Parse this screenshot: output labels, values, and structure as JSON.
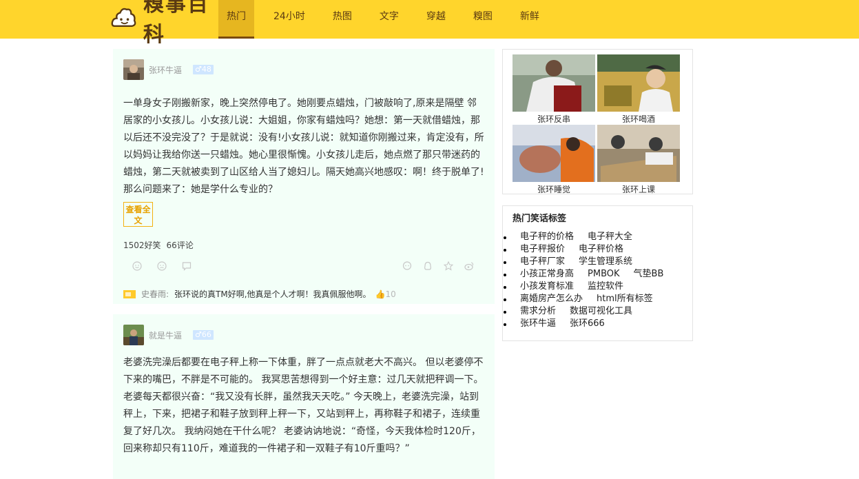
{
  "header": {
    "logo_text": "糗事百科",
    "nav": [
      "热门",
      "24小时",
      "热图",
      "文字",
      "穿越",
      "糗图",
      "新鲜"
    ],
    "active_nav": "热门"
  },
  "articles": [
    {
      "author": "张环牛逼",
      "level": "48",
      "content": "一单身女子刚搬新家，晚上突然停电了。她刚要点蜡烛，门被敲响了,原来是隔壁 邻居家的小女孩儿。小女孩儿说：大姐姐，你家有蜡烛吗？她想：第一天就借蜡烛，那以后还不没完没了？于是就说：没有!小女孩儿说：就知道你刚搬过来，肯定没有，所以妈妈让我给你送一只蜡烛。她心里很惭愧。小女孩儿走后，她点燃了那只带迷药的蜡烛，第二天就被卖到了山区给人当了媳妇儿。隔天她高兴地感叹：啊！终于脱单了!那么问题来了：她是学什么专业的？",
      "more_label": "查看全文",
      "funny": "1502好笑",
      "comments": "66评论",
      "hot_comment": {
        "user": "史春雨:",
        "text": "张环说的真TM好啊,他真是个人才啊！我真佩服他啊。",
        "likes": "10"
      }
    },
    {
      "author": "就是牛逼",
      "level": "66",
      "content": "老婆洗完澡后都要在电子秤上称一下体重，胖了一点点就老大不高兴。 但以老婆停不下来的嘴巴，不胖是不可能的。 我冥思苦想得到一个好主意：过几天就把秤调一下。 老婆每天都很兴奋：“我又没有长胖，虽然我天天吃。” 今天晚上，老婆洗完澡，站到秤上，下来，把裙子和鞋子放到秤上秤一下，又站到秤上，再称鞋子和裙子，连续重复了好几次。 我纳闷她在干什么呢？ 老婆讷讷地说：“奇怪，今天我体检时120斤，回来称却只有110斤，难道我的一件裙子和一双鞋子有10斤重吗？”"
    }
  ],
  "photos": [
    "张环反串",
    "张环喝酒",
    "张环睡觉",
    "张环上课"
  ],
  "tags": {
    "title": "热门笑话标签",
    "rows": [
      [
        "电子秤的价格",
        "电子秤大全"
      ],
      [
        "电子秤报价",
        "电子秤价格"
      ],
      [
        "电子秤厂家",
        "学生管理系统"
      ],
      [
        "小孩正常身高",
        "PMBOK",
        "气垫BB"
      ],
      [
        "小孩发育标准",
        "监控软件"
      ],
      [
        "离婚房产怎么办",
        "html所有标签"
      ],
      [
        "需求分析",
        "数据可视化工具"
      ],
      [
        "张环牛逼",
        "张环666"
      ]
    ]
  },
  "colors": {
    "header_bg": "#ffd52c",
    "accent": "#f3b10f",
    "card_bg": "#f3fff8"
  }
}
